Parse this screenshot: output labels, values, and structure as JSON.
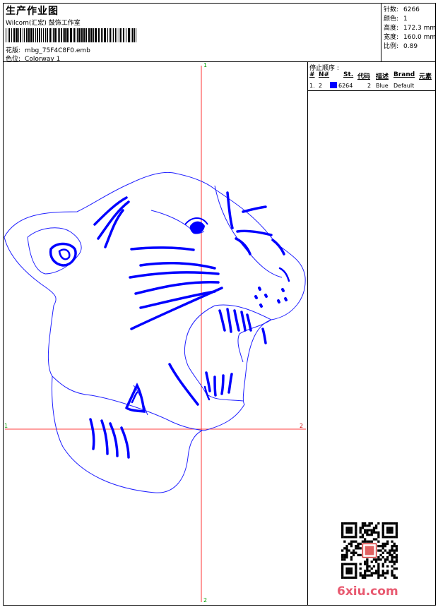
{
  "header": {
    "title": "生产作业图",
    "company": "Wilcom(汇宏) 鼓饰工作室",
    "design_label": "花版:",
    "design_value": "mbg_75F4C8F0.emb",
    "colorway_label": "色位:",
    "colorway_value": "Colorway 1"
  },
  "stats": [
    {
      "label": "针数:",
      "value": "6266"
    },
    {
      "label": "颜色:",
      "value": "1"
    },
    {
      "label": "高度:",
      "value": "172.3 mm"
    },
    {
      "label": "宽度:",
      "value": "160.0 mm"
    },
    {
      "label": "比例:",
      "value": "0.89"
    }
  ],
  "axes": {
    "top_label": "1",
    "bottom_label": "2",
    "left_label": "1",
    "right_label": "2"
  },
  "stop_sequence": {
    "title": "停止顺序 :",
    "columns": [
      "#",
      "N#",
      "St.",
      "代码",
      "描述",
      "Brand",
      "元素"
    ],
    "rows": [
      {
        "index": "1.",
        "needle": "2",
        "color": "#0000ff",
        "stitches": "6264",
        "code": "2",
        "description": "Blue",
        "brand": "Default",
        "elements": ""
      }
    ]
  },
  "watermark": "6xiu.com",
  "colors": {
    "stitch": "#0000ff",
    "outline": "#2020ff",
    "crosshair": "#ff0000"
  }
}
